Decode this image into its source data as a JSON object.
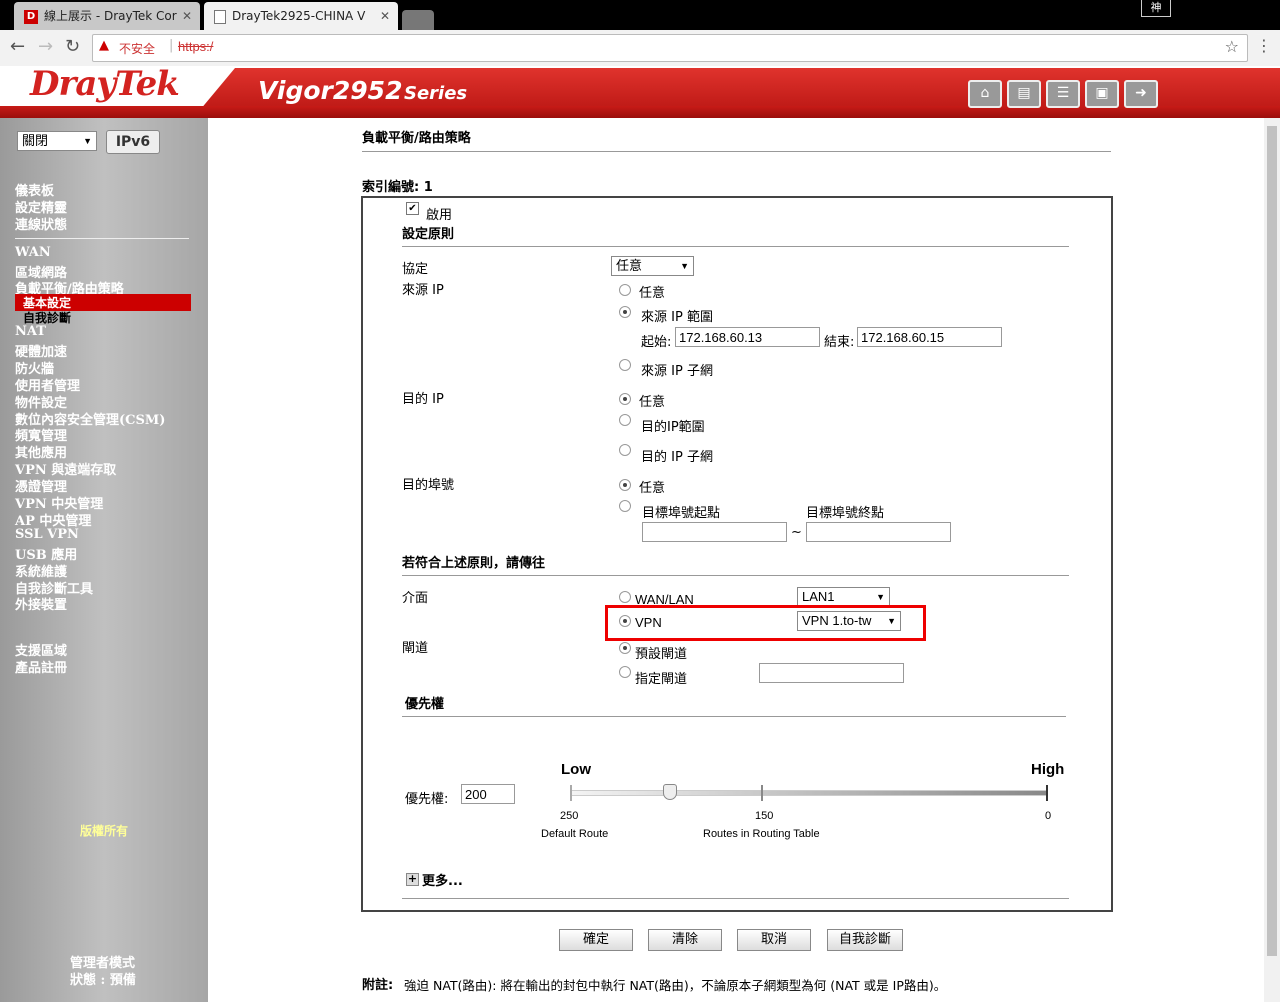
{
  "browser": {
    "tabs": [
      {
        "title": "線上展示 - DrayTek Cor",
        "close": "✕"
      },
      {
        "title": "DrayTek2925-CHINA V",
        "close": "✕"
      }
    ],
    "profile_label": "神",
    "security_label": "不安全",
    "url": "https:/"
  },
  "header": {
    "brand": "DrayTek",
    "model": "Vigor2952",
    "series": "Series"
  },
  "sidebar": {
    "dropdown_value": "關閉",
    "ipv6_label": "IPv6",
    "group1": [
      "儀表板",
      "設定精靈",
      "連線狀態"
    ],
    "group2": [
      "WAN",
      "區域網路",
      "負載平衡/路由策略"
    ],
    "sub_selected": "基本設定",
    "sub_item": "自我診斷",
    "group3": [
      "NAT",
      "硬體加速",
      "防火牆",
      "使用者管理",
      "物件設定",
      "數位內容安全管理(CSM)",
      "頻寬管理",
      "其他應用",
      "VPN 與遠端存取",
      "憑證管理",
      "VPN 中央管理",
      "AP 中央管理",
      "SSL VPN",
      "USB 應用",
      "系統維護",
      "自我診斷工具",
      "外接裝置"
    ],
    "group4": [
      "支援區域",
      "產品註冊"
    ],
    "copyright": "版權所有",
    "admin_mode": "管理者模式",
    "status": "狀態 : 預備"
  },
  "page": {
    "title": "負載平衡/路由策略",
    "index_label": "索引編號: 1",
    "enable_label": "啟用",
    "rule_section": "設定原則",
    "protocol_label": "協定",
    "protocol_value": "任意",
    "source_ip_label": "來源 IP",
    "any_label": "任意",
    "src_range_label": "來源 IP 範圍",
    "start_label": "起始:",
    "start_value": "172.168.60.13",
    "end_label": "結束:",
    "end_value": "172.168.60.15",
    "src_subnet_label": "來源 IP 子網",
    "dest_ip_label": "目的 IP",
    "dest_range_label": "目的IP範圍",
    "dest_subnet_label": "目的 IP 子網",
    "dest_port_label": "目的埠號",
    "port_start_label": "目標埠號起點",
    "port_end_label": "目標埠號終點",
    "tilde": "~",
    "send_section": "若符合上述原則，請傳往",
    "interface_label": "介面",
    "wanlan_label": "WAN/LAN",
    "wanlan_value": "LAN1",
    "vpn_label": "VPN",
    "vpn_value": "VPN 1.to-tw",
    "gateway_label": "閘道",
    "default_gw_label": "預設閘道",
    "specify_gw_label": "指定閘道",
    "priority_section": "優先權",
    "priority_label": "優先權:",
    "priority_value": "200",
    "slider": {
      "low": "Low",
      "high": "High",
      "tick_left": "250",
      "tick_mid": "150",
      "tick_right": "0",
      "default_route": "Default Route",
      "routes_table": "Routes in Routing Table",
      "level_fraction": 0.21
    },
    "more_label": "更多...",
    "buttons": {
      "ok": "確定",
      "clear": "清除",
      "cancel": "取消",
      "diagnose": "自我診斷"
    },
    "note_label": "附註:",
    "note_text": "強迫 NAT(路由): 將在輸出的封包中執行 NAT(路由)，不論原本子網類型為何 (NAT 或是 IP路由)。"
  }
}
